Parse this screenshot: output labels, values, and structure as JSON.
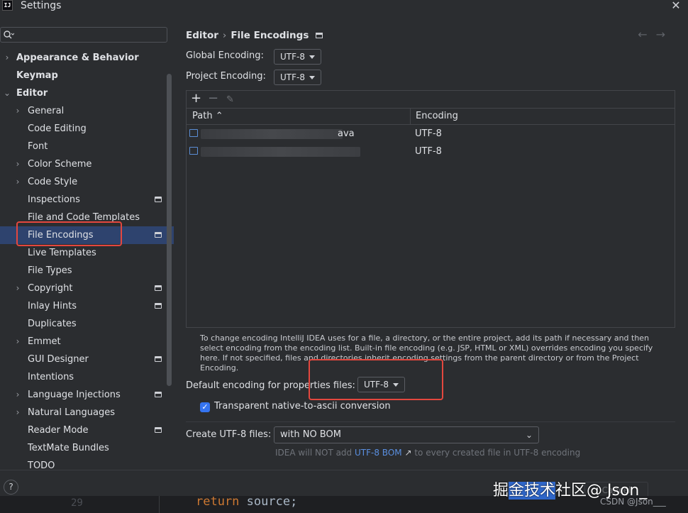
{
  "window": {
    "app_icon_text": "IJ",
    "title": "Settings",
    "close_glyph": "✕"
  },
  "sidebar": {
    "search_placeholder": "Q-",
    "items": [
      {
        "label": "Appearance & Behavior",
        "chevron": "›",
        "bold": true
      },
      {
        "label": "Keymap",
        "bold": true
      },
      {
        "label": "Editor",
        "chevron": "⌄",
        "bold": true
      },
      {
        "label": "General",
        "chevron": "›"
      },
      {
        "label": "Code Editing"
      },
      {
        "label": "Font"
      },
      {
        "label": "Color Scheme",
        "chevron": "›"
      },
      {
        "label": "Code Style",
        "chevron": "›"
      },
      {
        "label": "Inspections",
        "modified": true
      },
      {
        "label": "File and Code Templates"
      },
      {
        "label": "File Encodings",
        "modified": true,
        "selected": true
      },
      {
        "label": "Live Templates"
      },
      {
        "label": "File Types"
      },
      {
        "label": "Copyright",
        "chevron": "›",
        "modified": true
      },
      {
        "label": "Inlay Hints",
        "modified": true
      },
      {
        "label": "Duplicates"
      },
      {
        "label": "Emmet",
        "chevron": "›"
      },
      {
        "label": "GUI Designer",
        "modified": true
      },
      {
        "label": "Intentions"
      },
      {
        "label": "Language Injections",
        "chevron": "›",
        "modified": true
      },
      {
        "label": "Natural Languages",
        "chevron": "›"
      },
      {
        "label": "Reader Mode",
        "modified": true
      },
      {
        "label": "TextMate Bundles"
      },
      {
        "label": "TODO"
      }
    ]
  },
  "breadcrumb": {
    "parent": "Editor",
    "separator": "›",
    "current": "File Encodings"
  },
  "nav": {
    "back": "←",
    "forward": "→"
  },
  "global_encoding": {
    "label": "Global Encoding:",
    "value": "UTF-8"
  },
  "project_encoding": {
    "label": "Project Encoding:",
    "value": "UTF-8"
  },
  "table": {
    "toolbar": {
      "add": "+",
      "remove": "−",
      "edit": "✎"
    },
    "columns": {
      "path": "Path",
      "sort_arrow": "⌃",
      "encoding": "Encoding"
    },
    "rows": [
      {
        "path_visible_fragment": "ava",
        "encoding": "UTF-8"
      },
      {
        "path_visible_fragment": "",
        "encoding": "UTF-8"
      }
    ]
  },
  "help_text": "To change encoding IntelliJ IDEA uses for a file, a directory, or the entire project, add its path if necessary and then select encoding from the encoding list. Built-in file encoding (e.g. JSP, HTML or XML) overrides encoding you specify here. If not specified, files and directories inherit encoding settings from the parent directory or from the Project Encoding.",
  "default_properties": {
    "label": "Default encoding for properties files:",
    "value": "UTF-8"
  },
  "transparent": {
    "label": "Transparent native-to-ascii conversion",
    "checked": true,
    "check_glyph": "✓"
  },
  "create_utf8": {
    "label": "Create UTF-8 files:",
    "value": "with NO BOM",
    "chevron": "⌄"
  },
  "hint": {
    "prefix": "IDEA will NOT add",
    "link": "UTF-8 BOM",
    "link_arrow": "↗",
    "suffix": "to every created file in UTF-8 encoding"
  },
  "bottom": {
    "help": "?",
    "cancel": "Cancel",
    "line_number": "29",
    "code_keyword": "return",
    "code_rest": "source;",
    "watermark_prefix": "掘",
    "watermark_highlight": "金技术",
    "watermark_suffix": "社区@ Json_",
    "csdn": "CSDN @Json___"
  },
  "colors": {
    "accent": "#3574f0",
    "selection": "#2e436e",
    "annotation_red": "#e4473e",
    "link": "#5a8fe0"
  }
}
